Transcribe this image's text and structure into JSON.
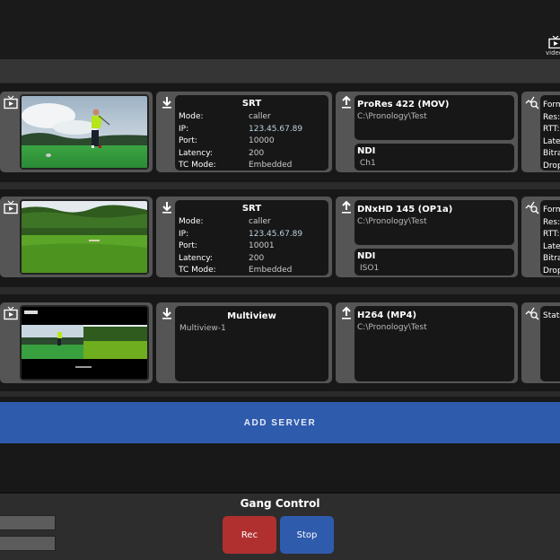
{
  "header": {
    "video_tab_label": "video"
  },
  "rows": [
    {
      "input": {
        "title": "SRT",
        "fields": [
          {
            "key": "Mode:",
            "value": "caller"
          },
          {
            "key": "IP:",
            "value": "123.45.67.89"
          },
          {
            "key": "Port:",
            "value": "10000"
          },
          {
            "key": "Latency:",
            "value": "200"
          },
          {
            "key": "TC Mode:",
            "value": "Embedded"
          }
        ]
      },
      "output_primary": {
        "title": "ProRes 422 (MOV)",
        "path": "C:\\Pronology\\Test"
      },
      "output_secondary": {
        "title": "NDI",
        "name": "Ch1"
      },
      "stats": [
        "Form",
        "Res:",
        "RTT:",
        "Late",
        "Bitra",
        "Drop"
      ]
    },
    {
      "input": {
        "title": "SRT",
        "fields": [
          {
            "key": "Mode:",
            "value": "caller"
          },
          {
            "key": "IP:",
            "value": "123.45.67.89"
          },
          {
            "key": "Port:",
            "value": "10001"
          },
          {
            "key": "Latency:",
            "value": "200"
          },
          {
            "key": "TC Mode:",
            "value": "Embedded"
          }
        ]
      },
      "output_primary": {
        "title": "DNxHD 145 (OP1a)",
        "path": "C:\\Pronology\\Test"
      },
      "output_secondary": {
        "title": "NDI",
        "name": "ISO1"
      },
      "stats": [
        "Form",
        "Res:",
        "RTT:",
        "Late",
        "Bitra",
        "Drop"
      ]
    },
    {
      "input": {
        "title": "Multiview",
        "name": "Multiview-1"
      },
      "output_primary": {
        "title": "H264 (MP4)",
        "path": "C:\\Pronology\\Test"
      },
      "stats": [
        "Stats"
      ]
    }
  ],
  "add_server_label": "ADD SERVER",
  "gang_control": {
    "title": "Gang Control",
    "rec_label": "Rec",
    "stop_label": "Stop"
  },
  "colors": {
    "accent_blue": "#2f5bad",
    "rec_red": "#b03030",
    "stop_blue": "#2f5bad"
  }
}
